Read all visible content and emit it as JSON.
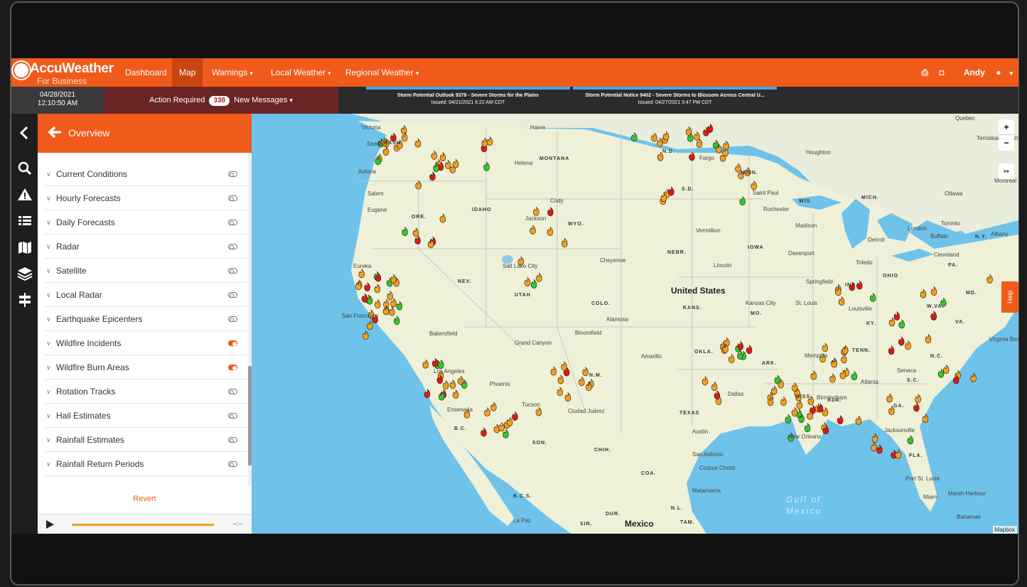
{
  "app": {
    "brand": "AccuWeather",
    "brand_sub": "For Business"
  },
  "nav": {
    "items": [
      {
        "label": "Dashboard",
        "caret": false,
        "active": false
      },
      {
        "label": "Map",
        "caret": false,
        "active": true
      },
      {
        "label": "Warnings",
        "caret": true,
        "active": false
      },
      {
        "label": "Local Weather",
        "caret": true,
        "active": false
      },
      {
        "label": "Regional Weather",
        "caret": true,
        "active": false
      }
    ],
    "user": "Andy",
    "icons": [
      "print-icon",
      "gift-icon",
      "user-icon"
    ]
  },
  "subbar": {
    "date": "04/28/2021",
    "time": "12:10:50 AM",
    "action_label": "Action Required",
    "message_count": "338",
    "messages_label": "New Messages"
  },
  "notices": [
    {
      "title": "Storm Potential Outlook 9379 - Severe Storms for the Plains",
      "issued": "Issued: 04/21/2021 6:22 AM CDT"
    },
    {
      "title": "Storm Potential Notice 9402 - Severe Storms to Blossom Across Central U...",
      "issued": "Issued: 04/27/2021 3:47 PM CDT"
    }
  ],
  "rail_icons": [
    "chevron-left-icon",
    "search-icon",
    "warning-icon",
    "list-icon",
    "map-icon",
    "layers-icon",
    "signpost-icon"
  ],
  "panel": {
    "title": "Overview",
    "layers": [
      {
        "label": "Current Conditions",
        "on": false
      },
      {
        "label": "Hourly Forecasts",
        "on": false
      },
      {
        "label": "Daily Forecasts",
        "on": false
      },
      {
        "label": "Radar",
        "on": false
      },
      {
        "label": "Satellite",
        "on": false
      },
      {
        "label": "Local Radar",
        "on": false
      },
      {
        "label": "Earthquake Epicenters",
        "on": false
      },
      {
        "label": "Wildfire Incidents",
        "on": true
      },
      {
        "label": "Wildfire Burn Areas",
        "on": true
      },
      {
        "label": "Rotation Tracks",
        "on": false
      },
      {
        "label": "Hail Estimates",
        "on": false
      },
      {
        "label": "Rainfall Estimates",
        "on": false
      },
      {
        "label": "Rainfall Return Periods",
        "on": false
      }
    ],
    "revert_label": "Revert",
    "player_time": "--:--"
  },
  "map": {
    "country": "United States",
    "mexico": "Mexico",
    "gulf": "Gulf of Mexico",
    "attribution": "Mapbox",
    "help_label": "Help",
    "zoom_in": "+",
    "zoom_out": "−",
    "expand_label": "↦",
    "states": [
      "WASH.",
      "ORE.",
      "IDAHO",
      "MONTANA",
      "WYO.",
      "NEV.",
      "UTAH",
      "COLO.",
      "N.M.",
      "KANS.",
      "OKLA.",
      "TEXAS",
      "NEBR.",
      "S.D.",
      "N.D.",
      "MINN.",
      "IOWA",
      "MO.",
      "ARK.",
      "TENN.",
      "KY.",
      "IND.",
      "OHIO",
      "WIS.",
      "MICH.",
      "MISS.",
      "ALA.",
      "GA.",
      "S.C.",
      "N.C.",
      "VA.",
      "W.VA.",
      "MD.",
      "PA.",
      "N.Y.",
      "FLA.",
      "B.C.",
      "SON.",
      "CHIH.",
      "COA.",
      "DUR.",
      "N.L.",
      "TAM.",
      "B.C.S.",
      "SIN."
    ],
    "cities": [
      "Victoria",
      "Seattle",
      "Havre",
      "Houghton",
      "Quebec",
      "Temiskaming Shores",
      "Astoria",
      "Helena",
      "Fargo",
      "Salem",
      "Eugene",
      "Cody",
      "Jackson",
      "Saint Paul",
      "Rochester",
      "Ottawa",
      "Montreal",
      "Toronto",
      "Detroit",
      "London",
      "Buffalo",
      "Albany",
      "Madison",
      "Eureka",
      "Salt Lake City",
      "Cheyenne",
      "Vermillion",
      "Davenport",
      "Lincoln",
      "Cleveland",
      "Toledo",
      "Springfield",
      "San Francisco",
      "Bakersfield",
      "Kansas City",
      "St. Louis",
      "Louisville",
      "Alamosa",
      "Bloomfield",
      "Grand Canyon",
      "Amarillo",
      "Memphis",
      "Seneca",
      "Los Angeles",
      "Phoenix",
      "Tucson",
      "Ensenada",
      "Ciudad Juárez",
      "Dallas",
      "Birmingham",
      "Atlanta",
      "Austin",
      "San Antonio",
      "Corpus Christi",
      "New Orleans",
      "Jacksonville",
      "Port St. Lucie",
      "Miami",
      "Marsh Harbour",
      "Bahamas",
      "Matamoros",
      "La Paz",
      "Virginia Beach",
      "Hav.",
      "Wi."
    ],
    "fire_legend": {
      "orange": "#f5a020",
      "red": "#e01818",
      "green": "#2ecc2e"
    }
  }
}
